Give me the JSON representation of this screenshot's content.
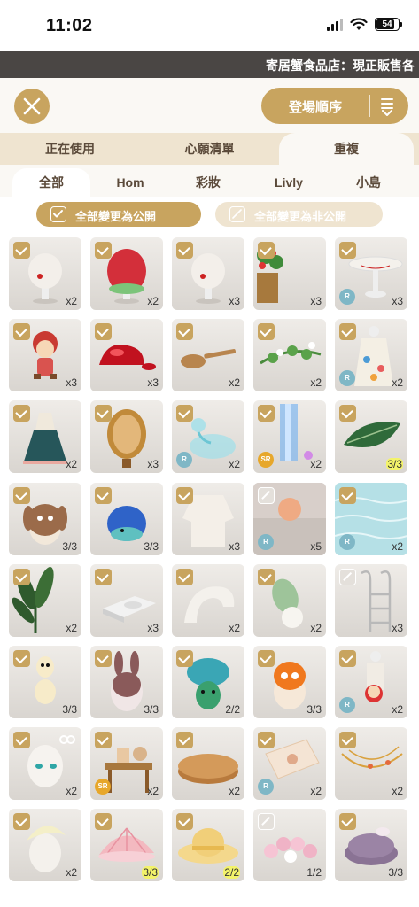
{
  "status_bar": {
    "time": "11:02",
    "battery": "54"
  },
  "ticker": {
    "text": "寄居蟹食品店：現正販售各"
  },
  "header": {
    "sort_label": "登場順序"
  },
  "main_tabs": [
    {
      "label": "正在使用",
      "active": false
    },
    {
      "label": "心願清單",
      "active": false
    },
    {
      "label": "重複",
      "active": true
    }
  ],
  "sub_tabs": [
    {
      "label": "全部",
      "active": true
    },
    {
      "label": "Hom",
      "active": false
    },
    {
      "label": "彩妝",
      "active": false
    },
    {
      "label": "Livly",
      "active": false
    },
    {
      "label": "小島",
      "active": false
    }
  ],
  "actions": {
    "make_public": "全部變更為公開",
    "make_private": "全部變更為非公開"
  },
  "items": [
    {
      "icon": "white-hat-icon",
      "count": "x2",
      "checked": true,
      "rarity": "",
      "highlight": false
    },
    {
      "icon": "strawberry-hat-icon",
      "count": "x2",
      "checked": true,
      "rarity": "",
      "highlight": false
    },
    {
      "icon": "white-hat-icon",
      "count": "x3",
      "checked": true,
      "rarity": "",
      "highlight": false
    },
    {
      "icon": "strawberry-plant-icon",
      "count": "x3",
      "checked": true,
      "rarity": "",
      "highlight": false
    },
    {
      "icon": "cake-stand-icon",
      "count": "x3",
      "checked": true,
      "rarity": "R",
      "highlight": false
    },
    {
      "icon": "doll-icon",
      "count": "x3",
      "checked": true,
      "rarity": "",
      "highlight": false
    },
    {
      "icon": "jelly-icon",
      "count": "x3",
      "checked": true,
      "rarity": "",
      "highlight": false
    },
    {
      "icon": "spoon-icon",
      "count": "x2",
      "checked": true,
      "rarity": "",
      "highlight": false
    },
    {
      "icon": "vine-icon",
      "count": "x2",
      "checked": true,
      "rarity": "",
      "highlight": false
    },
    {
      "icon": "floral-dress-icon",
      "count": "x2",
      "checked": true,
      "rarity": "R",
      "highlight": false
    },
    {
      "icon": "dress-icon",
      "count": "x2",
      "checked": true,
      "rarity": "",
      "highlight": false
    },
    {
      "icon": "mirror-icon",
      "count": "x3",
      "checked": true,
      "rarity": "",
      "highlight": false
    },
    {
      "icon": "glass-dome-icon",
      "count": "x2",
      "checked": true,
      "rarity": "R",
      "highlight": false
    },
    {
      "icon": "light-fountain-icon",
      "count": "x2",
      "checked": true,
      "rarity": "SR",
      "highlight": false
    },
    {
      "icon": "leaf-icon",
      "count": "3/3",
      "checked": true,
      "rarity": "",
      "highlight": true
    },
    {
      "icon": "bunny-egg-icon",
      "count": "3/3",
      "checked": true,
      "rarity": "",
      "highlight": false
    },
    {
      "icon": "blue-egg-icon",
      "count": "3/3",
      "checked": true,
      "rarity": "",
      "highlight": false
    },
    {
      "icon": "sweater-icon",
      "count": "x3",
      "checked": true,
      "rarity": "",
      "highlight": false
    },
    {
      "icon": "sunset-backdrop-icon",
      "count": "x5",
      "checked": false,
      "rarity": "R",
      "highlight": false
    },
    {
      "icon": "sea-backdrop-icon",
      "count": "x2",
      "checked": true,
      "rarity": "R",
      "highlight": false
    },
    {
      "icon": "palm-plant-icon",
      "count": "x2",
      "checked": true,
      "rarity": "",
      "highlight": false
    },
    {
      "icon": "bath-tile-icon",
      "count": "x3",
      "checked": true,
      "rarity": "",
      "highlight": false
    },
    {
      "icon": "white-arch-icon",
      "count": "x2",
      "checked": true,
      "rarity": "",
      "highlight": false
    },
    {
      "icon": "leaf-lamp-icon",
      "count": "x2",
      "checked": true,
      "rarity": "",
      "highlight": false
    },
    {
      "icon": "pool-ladder-icon",
      "count": "x3",
      "checked": false,
      "rarity": "",
      "highlight": false
    },
    {
      "icon": "chick-egg-icon",
      "count": "3/3",
      "checked": true,
      "rarity": "",
      "highlight": false
    },
    {
      "icon": "rabbit-egg-icon",
      "count": "3/3",
      "checked": true,
      "rarity": "",
      "highlight": false
    },
    {
      "icon": "mushroom-egg-icon",
      "count": "2/2",
      "checked": true,
      "rarity": "",
      "highlight": false
    },
    {
      "icon": "orange-egg-icon",
      "count": "3/3",
      "checked": true,
      "rarity": "",
      "highlight": false
    },
    {
      "icon": "mannequin-icon",
      "count": "x2",
      "checked": true,
      "rarity": "R",
      "highlight": false
    },
    {
      "icon": "face-makeup-icon",
      "count": "x2",
      "checked": true,
      "rarity": "",
      "highlight": false
    },
    {
      "icon": "workbench-icon",
      "count": "x2",
      "checked": true,
      "rarity": "SR",
      "highlight": false
    },
    {
      "icon": "wooden-tray-icon",
      "count": "x2",
      "checked": true,
      "rarity": "",
      "highlight": false
    },
    {
      "icon": "lace-cloth-icon",
      "count": "x2",
      "checked": true,
      "rarity": "R",
      "highlight": false
    },
    {
      "icon": "necklace-icon",
      "count": "x2",
      "checked": true,
      "rarity": "",
      "highlight": false
    },
    {
      "icon": "shell-hat-icon",
      "count": "x2",
      "checked": true,
      "rarity": "",
      "highlight": false
    },
    {
      "icon": "pink-shell-icon",
      "count": "3/3",
      "checked": true,
      "rarity": "",
      "highlight": true
    },
    {
      "icon": "sun-hat-icon",
      "count": "2/2",
      "checked": true,
      "rarity": "",
      "highlight": true
    },
    {
      "icon": "flower-crown-icon",
      "count": "1/2",
      "checked": false,
      "rarity": "",
      "highlight": false
    },
    {
      "icon": "beret-icon",
      "count": "3/3",
      "checked": true,
      "rarity": "",
      "highlight": false
    }
  ]
}
